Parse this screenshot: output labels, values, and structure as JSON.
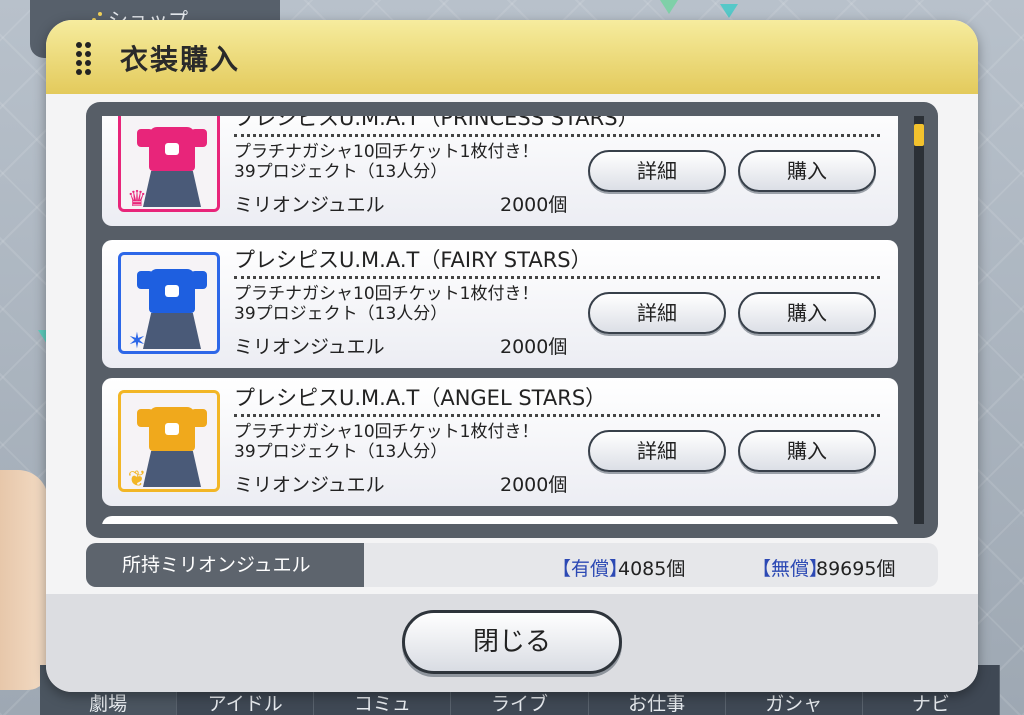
{
  "background": {
    "shop_tab_label": "ショップ",
    "nav": [
      "劇場",
      "アイドル",
      "コミュ",
      "ライブ",
      "お仕事",
      "ガシャ",
      "ナビ"
    ]
  },
  "dialog": {
    "title": "衣装購入",
    "items": [
      {
        "name": "プレシピスU.M.A.T（PRINCESS STARS）",
        "desc_line1": "プラチナガシャ10回チケット1枚付き！",
        "desc_line2": "39プロジェクト（13人分）",
        "currency": "ミリオンジュエル",
        "price": "2000個",
        "detail_label": "詳細",
        "buy_label": "購入",
        "shirt_color": "#e8257a",
        "frame_color": "#e8257a",
        "emblem": "crown-icon"
      },
      {
        "name": "プレシピスU.M.A.T（FAIRY STARS）",
        "desc_line1": "プラチナガシャ10回チケット1枚付き！",
        "desc_line2": "39プロジェクト（13人分）",
        "currency": "ミリオンジュエル",
        "price": "2000個",
        "detail_label": "詳細",
        "buy_label": "購入",
        "shirt_color": "#1e5fe0",
        "frame_color": "#2d67e8",
        "emblem": "star-icon"
      },
      {
        "name": "プレシピスU.M.A.T（ANGEL STARS）",
        "desc_line1": "プラチナガシャ10回チケット1枚付き！",
        "desc_line2": "39プロジェクト（13人分）",
        "currency": "ミリオンジュエル",
        "price": "2000個",
        "detail_label": "詳細",
        "buy_label": "購入",
        "shirt_color": "#f0a91c",
        "frame_color": "#f2b626",
        "emblem": "wing-icon"
      }
    ],
    "owned": {
      "label": "所持ミリオンジュエル",
      "paid_tag": "【有償】",
      "paid_value": "4085個",
      "free_tag": "【無償】",
      "free_value": "89695個"
    },
    "close_label": "閉じる"
  }
}
